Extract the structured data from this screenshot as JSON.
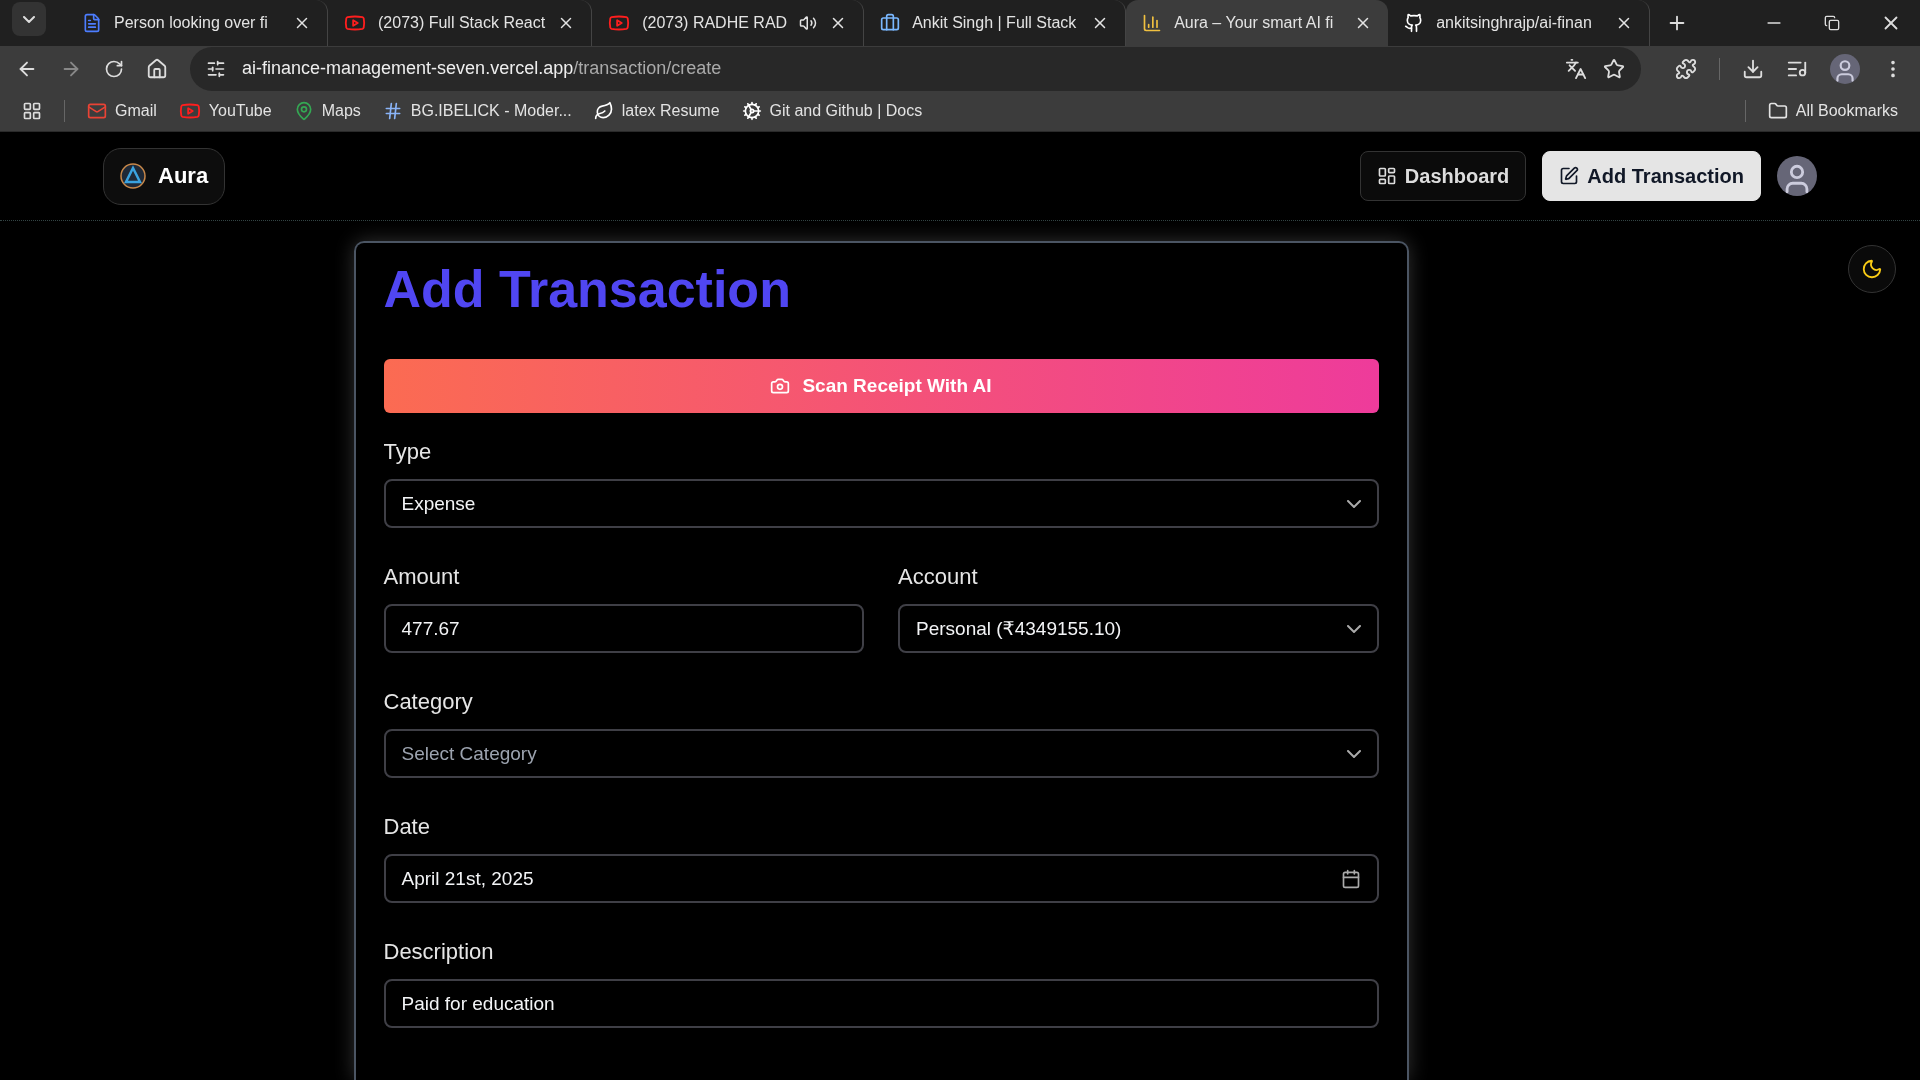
{
  "browser": {
    "tabs": [
      {
        "title": "Person looking over fi",
        "selected": false,
        "audio": false
      },
      {
        "title": "(2073) Full Stack React",
        "selected": false,
        "audio": false
      },
      {
        "title": "(2073) RADHE RAD",
        "selected": false,
        "audio": true
      },
      {
        "title": "Ankit Singh | Full Stack",
        "selected": false,
        "audio": false
      },
      {
        "title": "Aura – Your smart AI fi",
        "selected": true,
        "audio": false
      },
      {
        "title": "ankitsinghrajp/ai-finan",
        "selected": false,
        "audio": false
      }
    ],
    "url_host": "ai-finance-management-seven.vercel.app",
    "url_path": "/transaction/create",
    "bookmarks": [
      {
        "label": "Gmail"
      },
      {
        "label": "YouTube"
      },
      {
        "label": "Maps"
      },
      {
        "label": "BG.IBELICK - Moder..."
      },
      {
        "label": "latex Resume"
      },
      {
        "label": "Git and Github | Docs"
      }
    ],
    "all_bookmarks": "All Bookmarks"
  },
  "app": {
    "brand": "Aura",
    "nav": [
      {
        "label": "Dashboard",
        "kind": "outline"
      },
      {
        "label": "Add Transaction",
        "kind": "solid"
      }
    ],
    "title": "Add Transaction",
    "scan_button": "Scan Receipt With AI",
    "rows": [
      [
        {
          "kind": "select",
          "label": "Type",
          "value": "Expense"
        }
      ],
      [
        {
          "kind": "input",
          "label": "Amount",
          "value": "477.67"
        },
        {
          "kind": "select",
          "label": "Account",
          "value": "Personal (₹4349155.10)"
        }
      ],
      [
        {
          "kind": "select",
          "label": "Category",
          "placeholder": "Select Category"
        }
      ],
      [
        {
          "kind": "date",
          "label": "Date",
          "value": "April 21st, 2025"
        }
      ],
      [
        {
          "kind": "input",
          "label": "Description",
          "value": "Paid for education"
        }
      ]
    ]
  }
}
